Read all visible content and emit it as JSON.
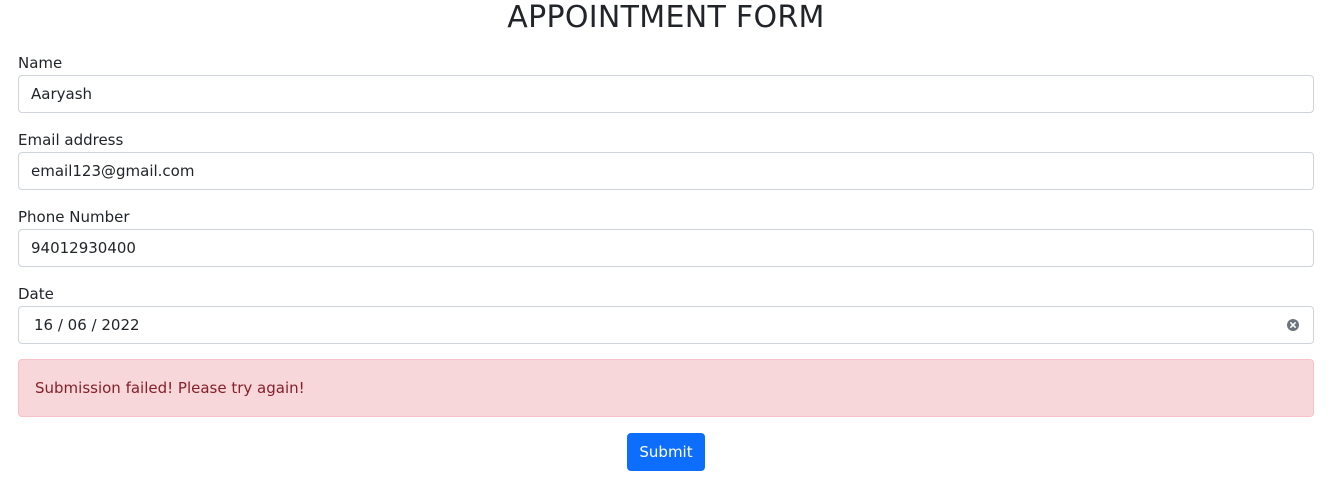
{
  "form": {
    "title": "APPOINTMENT FORM",
    "fields": [
      {
        "label": "Name",
        "value": "Aaryash"
      },
      {
        "label": "Email address",
        "value": "email123@gmail.com"
      },
      {
        "label": "Phone Number",
        "value": "94012930400"
      },
      {
        "label": "Date",
        "value": "16 / 06 / 2022"
      }
    ],
    "alert": {
      "message": "Submission failed! Please try again!",
      "color": "#842029",
      "background": "#f8d7da"
    },
    "submit_label": "Submit",
    "accent": "#0d6efd",
    "date_clear_icon": "clear-circle-icon"
  }
}
